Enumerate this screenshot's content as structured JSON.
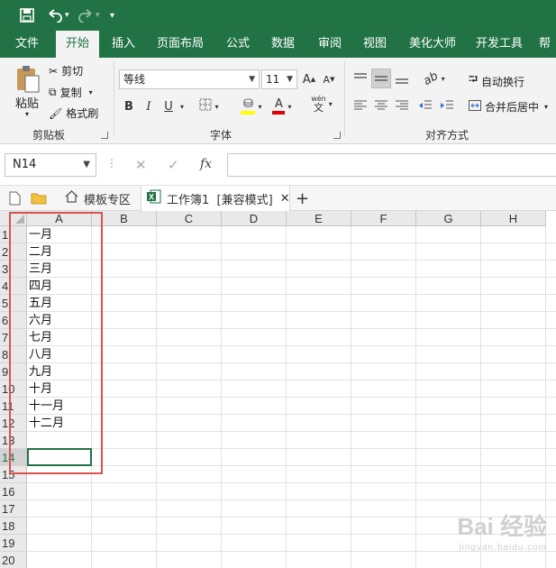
{
  "quick_access": {
    "save_icon": "save-icon",
    "undo_icon": "undo-icon",
    "redo_icon": "redo-icon",
    "customize_icon": "customize-qa-icon"
  },
  "menu_tabs": [
    "文件",
    "开始",
    "插入",
    "页面布局",
    "公式",
    "数据",
    "审阅",
    "视图",
    "美化大师",
    "开发工具",
    "帮"
  ],
  "active_tab": "开始",
  "ribbon": {
    "clipboard": {
      "paste": "粘贴",
      "cut": "剪切",
      "copy": "复制",
      "format_painter": "格式刷",
      "group_label": "剪贴板"
    },
    "font": {
      "font_name": "等线",
      "font_size": "11",
      "grow": "A",
      "shrink": "A",
      "bold": "B",
      "italic": "I",
      "underline": "U",
      "font_color": "A",
      "phonetic": "wén",
      "phonetic_char": "文",
      "group_label": "字体"
    },
    "alignment": {
      "wrap_text": "自动换行",
      "merge_center": "合并后居中",
      "group_label": "对齐方式"
    }
  },
  "formula_bar": {
    "name_box": "N14",
    "fx": "fx",
    "formula": ""
  },
  "doc_tabs": {
    "template_tab": "模板专区",
    "workbook_tab": "工作簿1  [兼容模式]",
    "add": "+"
  },
  "grid": {
    "columns": [
      "A",
      "B",
      "C",
      "D",
      "E",
      "F",
      "G",
      "H"
    ],
    "row_numbers": [
      "1",
      "2",
      "3",
      "4",
      "5",
      "6",
      "7",
      "8",
      "9",
      "10",
      "11",
      "12",
      "13",
      "14",
      "15",
      "16",
      "17",
      "18",
      "19",
      "20"
    ],
    "column_a_values": [
      "一月",
      "二月",
      "三月",
      "四月",
      "五月",
      "六月",
      "七月",
      "八月",
      "九月",
      "十月",
      "十一月",
      "十二月"
    ],
    "selected_row": "14"
  },
  "watermark": {
    "brand": "Bai 经验",
    "url": "jingyan.baidu.com"
  },
  "colors": {
    "accent": "#217346",
    "highlight_box": "#d9534f"
  }
}
